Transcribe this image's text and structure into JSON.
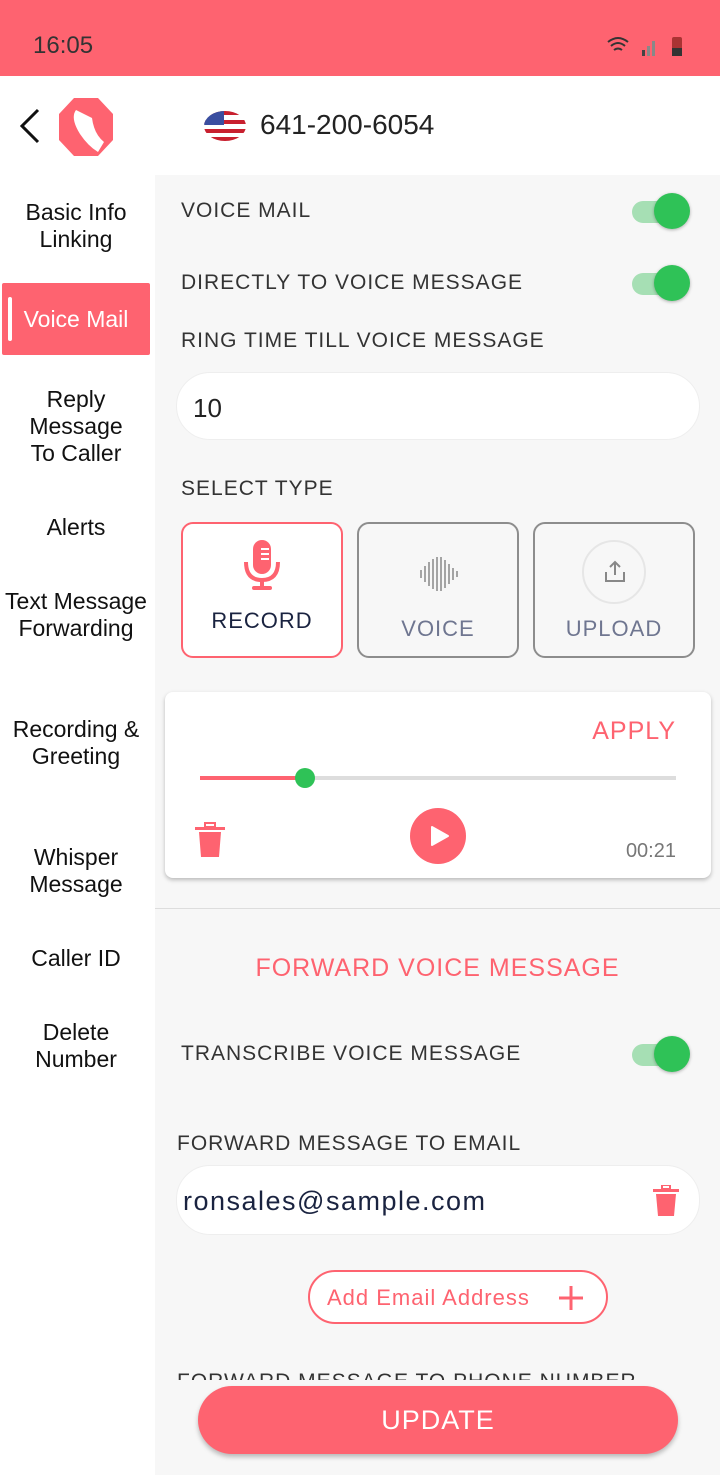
{
  "status_bar": {
    "time": "16:05"
  },
  "header": {
    "phone_number": "641-200-6054",
    "country": "US"
  },
  "sidebar": {
    "items": [
      {
        "label": "Basic Info Linking"
      },
      {
        "label": "Voice Mail",
        "active": true
      },
      {
        "label": "Reply Message To Caller"
      },
      {
        "label": "Alerts"
      },
      {
        "label": "Text Message Forwarding"
      },
      {
        "label": "Recording & Greeting"
      },
      {
        "label": "Whisper Message"
      },
      {
        "label": "Caller ID"
      },
      {
        "label": "Delete Number"
      }
    ]
  },
  "main": {
    "voice_mail_label": "VOICE MAIL",
    "voice_mail_on": true,
    "direct_label": "DIRECTLY TO VOICE MESSAGE",
    "direct_on": true,
    "ring_label": "RING TIME TILL VOICE MESSAGE",
    "ring_value": "10",
    "select_type_label": "SELECT TYPE",
    "types": [
      {
        "label": "RECORD",
        "selected": true
      },
      {
        "label": "VOICE"
      },
      {
        "label": "UPLOAD"
      }
    ],
    "player": {
      "apply": "APPLY",
      "progress": 0.22,
      "duration": "00:21"
    },
    "forward_title": "FORWARD VOICE MESSAGE",
    "transcribe_label": "TRANSCRIBE VOICE MESSAGE",
    "transcribe_on": true,
    "email_label": "FORWARD MESSAGE TO EMAIL",
    "email_value": "ronsales@sample.com",
    "add_email": "Add Email Address",
    "phone_label": "FORWARD MESSAGE TO PHONE NUMBER",
    "update": "UPDATE"
  },
  "colors": {
    "accent": "#fe6370",
    "toggle_on": "#2fc257"
  }
}
